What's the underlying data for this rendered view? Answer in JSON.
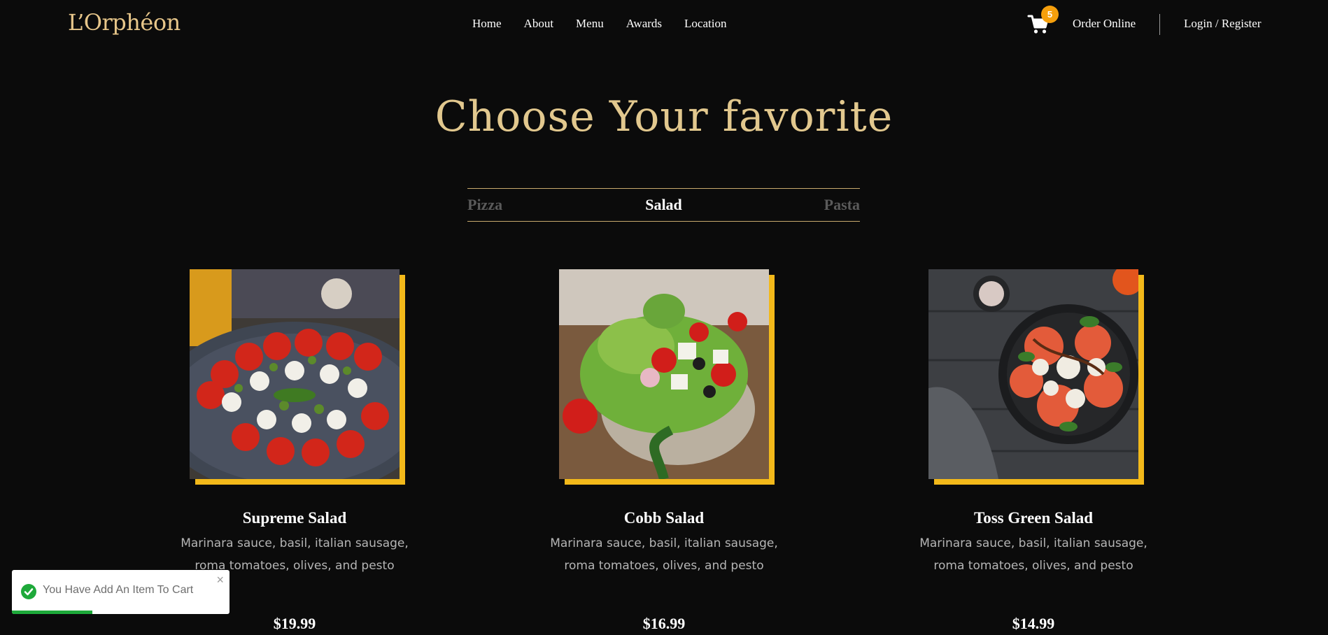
{
  "header": {
    "logo": "L’Orphéon",
    "nav": [
      "Home",
      "About",
      "Menu",
      "Awards",
      "Location"
    ],
    "cart_count": "5",
    "order_online": "Order Online",
    "login": "Login / Register"
  },
  "main": {
    "title": "Choose Your favorite",
    "tabs": [
      "Pizza",
      "Salad",
      "Pasta"
    ],
    "active_tab": "Salad",
    "items": [
      {
        "name": "Supreme Salad",
        "desc": "Marinara sauce, basil, italian sausage, roma tomatoes, olives, and pesto",
        "price": "$19.99"
      },
      {
        "name": "Cobb Salad",
        "desc": "Marinara sauce, basil, italian sausage, roma tomatoes, olives, and pesto",
        "price": "$16.99"
      },
      {
        "name": "Toss Green Salad",
        "desc": "Marinara sauce, basil, italian sausage, roma tomatoes, olives, and pesto",
        "price": "$14.99"
      }
    ]
  },
  "toast": {
    "message": "You Have Add An Item To Cart",
    "close": "×",
    "progress": 0.37
  },
  "colors": {
    "background": "#0b0b0b",
    "accent_gold": "#e2c88e",
    "image_frame": "#f3b91a",
    "badge": "#f59f0c",
    "success": "#1ea93a"
  },
  "icons": [
    "cart-icon",
    "check-circle-icon",
    "close-icon"
  ]
}
